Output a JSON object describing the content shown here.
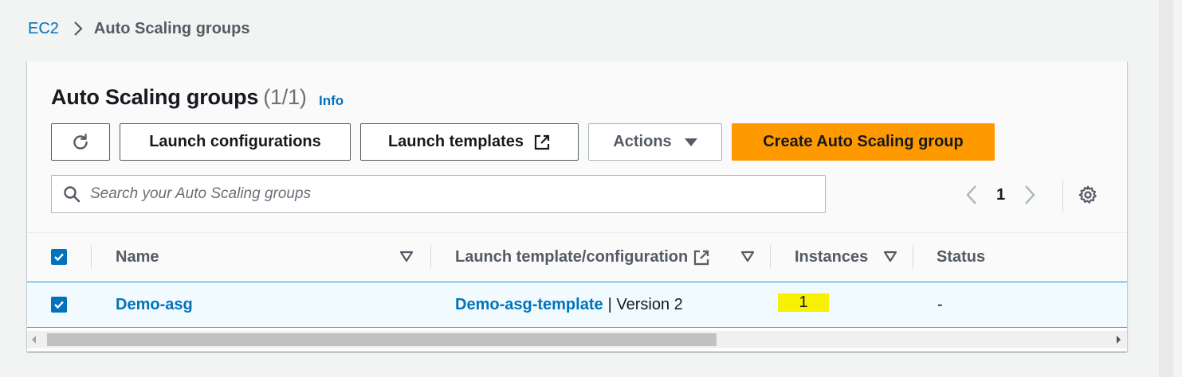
{
  "breadcrumb": {
    "root": "EC2",
    "current": "Auto Scaling groups"
  },
  "header": {
    "title": "Auto Scaling groups",
    "count": "(1/1)",
    "info": "Info"
  },
  "toolbar": {
    "launch_configurations": "Launch configurations",
    "launch_templates": "Launch templates",
    "actions": "Actions",
    "create": "Create Auto Scaling group"
  },
  "search": {
    "placeholder": "Search your Auto Scaling groups",
    "value": ""
  },
  "pagination": {
    "current_page": "1"
  },
  "table": {
    "columns": [
      "Name",
      "Launch template/configuration",
      "Instances",
      "Status"
    ],
    "rows": [
      {
        "selected": true,
        "name": "Demo-asg",
        "template": "Demo-asg-template",
        "version": "| Version 2",
        "instances": "1",
        "status": "-"
      }
    ]
  },
  "colors": {
    "accent": "#0073bb",
    "primary_button": "#ff9900",
    "highlight": "#f5f100"
  },
  "icons": [
    "chevron-right-icon",
    "refresh-icon",
    "external-link-icon",
    "caret-down-icon",
    "search-icon",
    "chevron-left-icon",
    "gear-icon",
    "sort-icon",
    "checkbox-checked-icon"
  ]
}
